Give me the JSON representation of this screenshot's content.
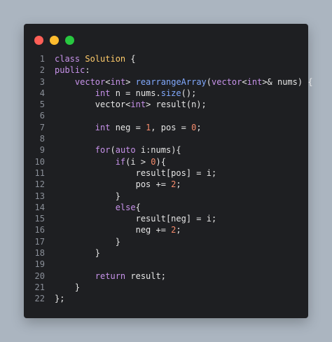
{
  "window": {
    "controls": [
      "close-icon",
      "minimize-icon",
      "maximize-icon"
    ],
    "colors": {
      "close": "#ff5f57",
      "minimize": "#febc2e",
      "maximize": "#28c840",
      "background": "#1e1f22"
    }
  },
  "code": {
    "lines": [
      {
        "n": "1",
        "tokens": [
          [
            "kw",
            "class"
          ],
          [
            "tx",
            " "
          ],
          [
            "cl",
            "Solution"
          ],
          [
            "tx",
            " {"
          ]
        ]
      },
      {
        "n": "2",
        "tokens": [
          [
            "kw",
            "public"
          ],
          [
            "tx",
            ":"
          ]
        ]
      },
      {
        "n": "3",
        "tokens": [
          [
            "tx",
            "    "
          ],
          [
            "kw",
            "vector"
          ],
          [
            "tx",
            "<"
          ],
          [
            "kw",
            "int"
          ],
          [
            "tx",
            "> "
          ],
          [
            "fn",
            "rearrangeArray"
          ],
          [
            "tx",
            "("
          ],
          [
            "kw",
            "vector"
          ],
          [
            "tx",
            "<"
          ],
          [
            "kw",
            "int"
          ],
          [
            "tx",
            ">& nums) {"
          ]
        ]
      },
      {
        "n": "4",
        "tokens": [
          [
            "tx",
            "        "
          ],
          [
            "kw",
            "int"
          ],
          [
            "tx",
            " n = nums."
          ],
          [
            "fn",
            "size"
          ],
          [
            "tx",
            "();"
          ]
        ]
      },
      {
        "n": "5",
        "tokens": [
          [
            "tx",
            "        vector<"
          ],
          [
            "kw",
            "int"
          ],
          [
            "tx",
            "> result(n);"
          ]
        ]
      },
      {
        "n": "6",
        "tokens": []
      },
      {
        "n": "7",
        "tokens": [
          [
            "tx",
            "        "
          ],
          [
            "kw",
            "int"
          ],
          [
            "tx",
            " neg = "
          ],
          [
            "nm",
            "1"
          ],
          [
            "tx",
            ", pos = "
          ],
          [
            "nm",
            "0"
          ],
          [
            "tx",
            ";"
          ]
        ]
      },
      {
        "n": "8",
        "tokens": []
      },
      {
        "n": "9",
        "tokens": [
          [
            "tx",
            "        "
          ],
          [
            "kw",
            "for"
          ],
          [
            "tx",
            "("
          ],
          [
            "kw",
            "auto"
          ],
          [
            "tx",
            " i:nums){"
          ]
        ]
      },
      {
        "n": "10",
        "tokens": [
          [
            "tx",
            "            "
          ],
          [
            "kw",
            "if"
          ],
          [
            "tx",
            "(i > "
          ],
          [
            "nm",
            "0"
          ],
          [
            "tx",
            "){"
          ]
        ]
      },
      {
        "n": "11",
        "tokens": [
          [
            "tx",
            "                result[pos] = i;"
          ]
        ]
      },
      {
        "n": "12",
        "tokens": [
          [
            "tx",
            "                pos += "
          ],
          [
            "nm",
            "2"
          ],
          [
            "tx",
            ";"
          ]
        ]
      },
      {
        "n": "13",
        "tokens": [
          [
            "tx",
            "            }"
          ]
        ]
      },
      {
        "n": "14",
        "tokens": [
          [
            "tx",
            "            "
          ],
          [
            "kw",
            "else"
          ],
          [
            "tx",
            "{"
          ]
        ]
      },
      {
        "n": "15",
        "tokens": [
          [
            "tx",
            "                result[neg] = i;"
          ]
        ]
      },
      {
        "n": "16",
        "tokens": [
          [
            "tx",
            "                neg += "
          ],
          [
            "nm",
            "2"
          ],
          [
            "tx",
            ";"
          ]
        ]
      },
      {
        "n": "17",
        "tokens": [
          [
            "tx",
            "            }"
          ]
        ]
      },
      {
        "n": "18",
        "tokens": [
          [
            "tx",
            "        }"
          ]
        ]
      },
      {
        "n": "19",
        "tokens": []
      },
      {
        "n": "20",
        "tokens": [
          [
            "tx",
            "        "
          ],
          [
            "kw",
            "return"
          ],
          [
            "tx",
            " result;"
          ]
        ]
      },
      {
        "n": "21",
        "tokens": [
          [
            "tx",
            "    }"
          ]
        ]
      },
      {
        "n": "22",
        "tokens": [
          [
            "tx",
            "};"
          ]
        ]
      }
    ]
  }
}
